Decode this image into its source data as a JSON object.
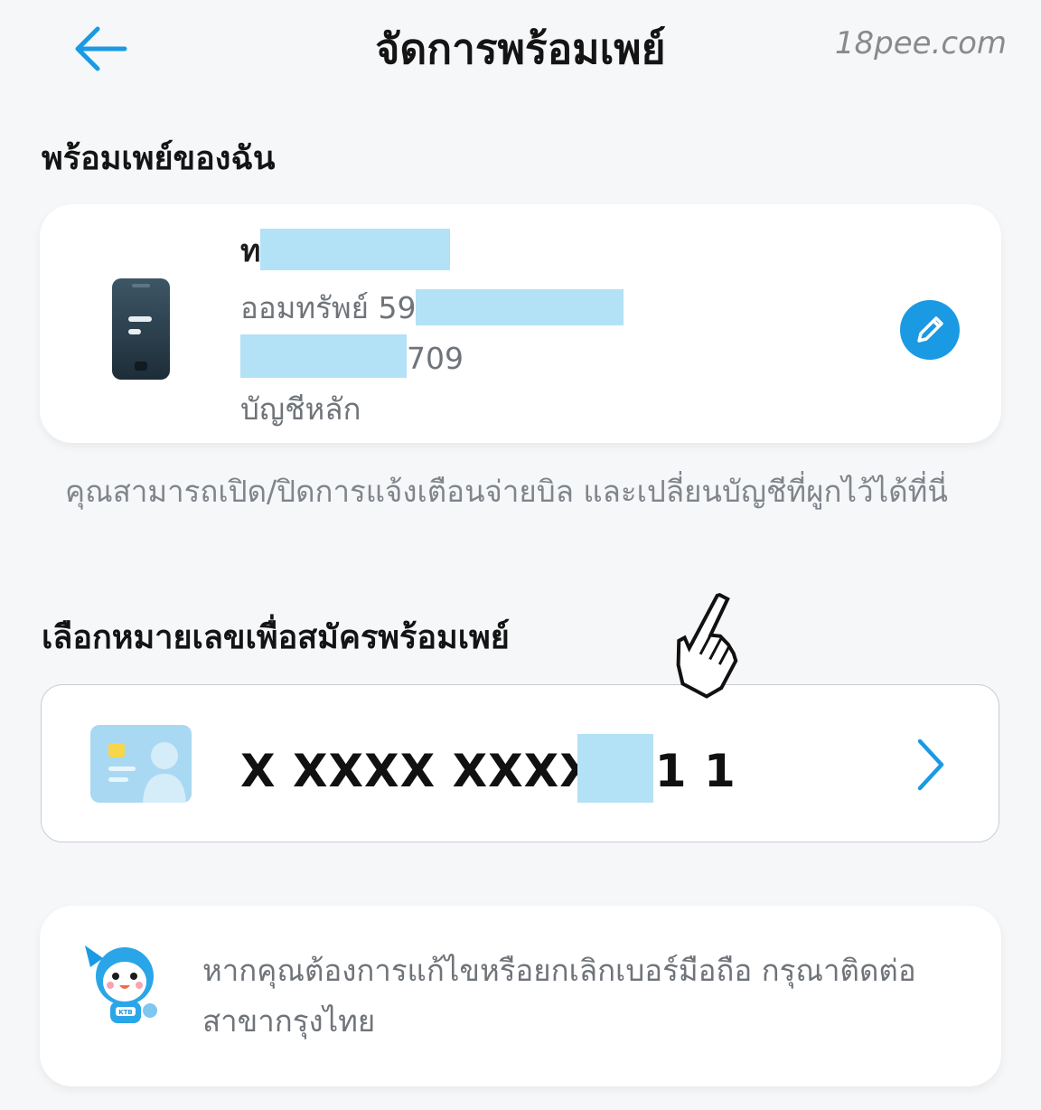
{
  "header": {
    "title": "จัดการพร้อมเพย์",
    "watermark": "18pee.com",
    "back_icon": "arrow-left-icon",
    "accent_color": "#1a9ae3"
  },
  "my_promptpay": {
    "section_title": "พร้อมเพย์ของฉัน",
    "card": {
      "icon": "mobile-phone-icon",
      "name_visible": "ท",
      "account_prefix": "ออมทรัพย์ 59",
      "account_suffix": "709",
      "account_type": "บัญชีหลัก",
      "edit_icon": "pencil-icon"
    },
    "hint": "คุณสามารถเปิด/ปิดการแจ้งเตือนจ่ายบิล และเปลี่ยนบัญชีที่ผูกไว้ได้ที่นี่"
  },
  "register": {
    "section_title": "เลือกหมายเลขเพื่อสมัครพร้อมเพย์",
    "option": {
      "icon": "id-card-icon",
      "number_prefix": "X XXXX XXXX",
      "number_suffix": "1 1",
      "chevron_icon": "chevron-right-icon"
    }
  },
  "notice": {
    "icon": "ktb-mascot-icon",
    "mascot_label": "KTB",
    "text": "หากคุณต้องการแก้ไขหรือยกเลิกเบอร์มือถือ กรุณาติดต่อสาขากรุงไทย"
  }
}
